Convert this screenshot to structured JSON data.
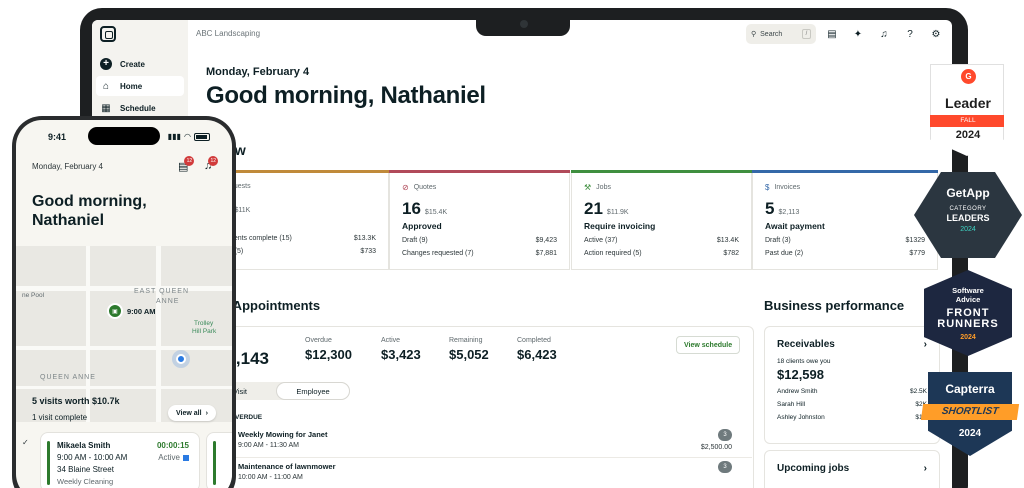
{
  "laptop": {
    "company": "ABC Landscaping",
    "sidebar": [
      {
        "label": "Create",
        "icon": "plus-circle-icon"
      },
      {
        "label": "Home",
        "icon": "home-icon"
      },
      {
        "label": "Schedule",
        "icon": "calendar-icon"
      }
    ],
    "search": {
      "placeholder": "Search",
      "shortcut": "/"
    },
    "date": "Monday, February 4",
    "greeting": "Good morning, Nathaniel",
    "workflow": {
      "title": "kflow",
      "cards": [
        {
          "label": "Requests",
          "count": "1",
          "sub": "$11K",
          "status": "w",
          "color": "#c08a3a",
          "rows": [
            {
              "l": "ssments complete (15)",
              "v": "$13.3K"
            },
            {
              "l": "due (5)",
              "v": "$733"
            }
          ]
        },
        {
          "label": "Quotes",
          "count": "16",
          "sub": "$15.4K",
          "status": "Approved",
          "color": "#b14a5a",
          "rows": [
            {
              "l": "Draft (9)",
              "v": "$9,423"
            },
            {
              "l": "Changes requested (7)",
              "v": "$7,881"
            }
          ]
        },
        {
          "label": "Jobs",
          "count": "21",
          "sub": "$11.9K",
          "status": "Require invoicing",
          "color": "#3f8f3f",
          "rows": [
            {
              "l": "Active (37)",
              "v": "$13.4K"
            },
            {
              "l": "Action required (5)",
              "v": "$782"
            }
          ]
        },
        {
          "label": "Invoices",
          "count": "5",
          "sub": "$2,113",
          "status": "Await payment",
          "color": "#3468a8",
          "rows": [
            {
              "l": "Draft (3)",
              "v": "$1329"
            },
            {
              "l": "Past due (2)",
              "v": "$779"
            }
          ]
        }
      ]
    },
    "appointments": {
      "title": "y's Appointments",
      "total": "28,143",
      "stats": [
        {
          "label": "Overdue",
          "value": "$12,300"
        },
        {
          "label": "Active",
          "value": "$3,423"
        },
        {
          "label": "Remaining",
          "value": "$5,052"
        },
        {
          "label": "Completed",
          "value": "$6,423"
        }
      ],
      "view_schedule": "View schedule",
      "segments": [
        "Visit",
        "Employee"
      ],
      "overdue_heading": "OVERDUE",
      "visits": [
        {
          "title": "Weekly Mowing for Janet",
          "time": "9:00 AM - 11:30 AM",
          "badge": "3",
          "amount": "$2,500.00"
        },
        {
          "title": "Maintenance of lawnmower",
          "time": "10:00 AM - 11:00 AM",
          "badge": "3",
          "amount": ""
        }
      ]
    },
    "business": {
      "title": "Business performance",
      "receivables": {
        "title": "Receivables",
        "sub": "18 clients owe you",
        "amount": "$12,598",
        "rows": [
          {
            "l": "Andrew Smith",
            "v": "$2.5K"
          },
          {
            "l": "Sarah Hill",
            "v": "$2K"
          },
          {
            "l": "Ashley Johnston",
            "v": "$1K"
          }
        ]
      },
      "upcoming": {
        "title": "Upcoming jobs"
      }
    }
  },
  "phone": {
    "time": "9:41",
    "date": "Monday, February 4",
    "chat_badge": "12",
    "bell_badge": "12",
    "greeting": "Good morning, Nathaniel",
    "map": {
      "labels": [
        "EAST QUEEN",
        "ANNE",
        "QUEEN ANNE"
      ],
      "park": [
        "Trolley",
        "Hill Park"
      ],
      "pool": "ne Pool",
      "pin_time": "9:00 AM"
    },
    "summary": "5 visits worth $10.7k",
    "sub": "1 visit complete",
    "view_all": "View all",
    "visit": {
      "name": "Mikaela Smith",
      "timer": "00:00:15",
      "time": "9:00 AM - 10:00 AM",
      "status": "Active",
      "address": "34 Blaine Street",
      "type": "Weekly Cleaning"
    }
  },
  "badges": {
    "g2": {
      "title": "Leader",
      "ribbon": "FALL",
      "year": "2024"
    },
    "getapp": {
      "name": "GetApp",
      "category": "CATEGORY",
      "leaders": "LEADERS",
      "year": "2024"
    },
    "software_advice": {
      "name_line1": "Software",
      "name_line2": "Advice",
      "front": "FRONT",
      "runners": "RUNNERS",
      "year": "2024"
    },
    "capterra": {
      "name": "Capterra",
      "shortlist": "SHORTLIST",
      "year": "2024"
    }
  }
}
